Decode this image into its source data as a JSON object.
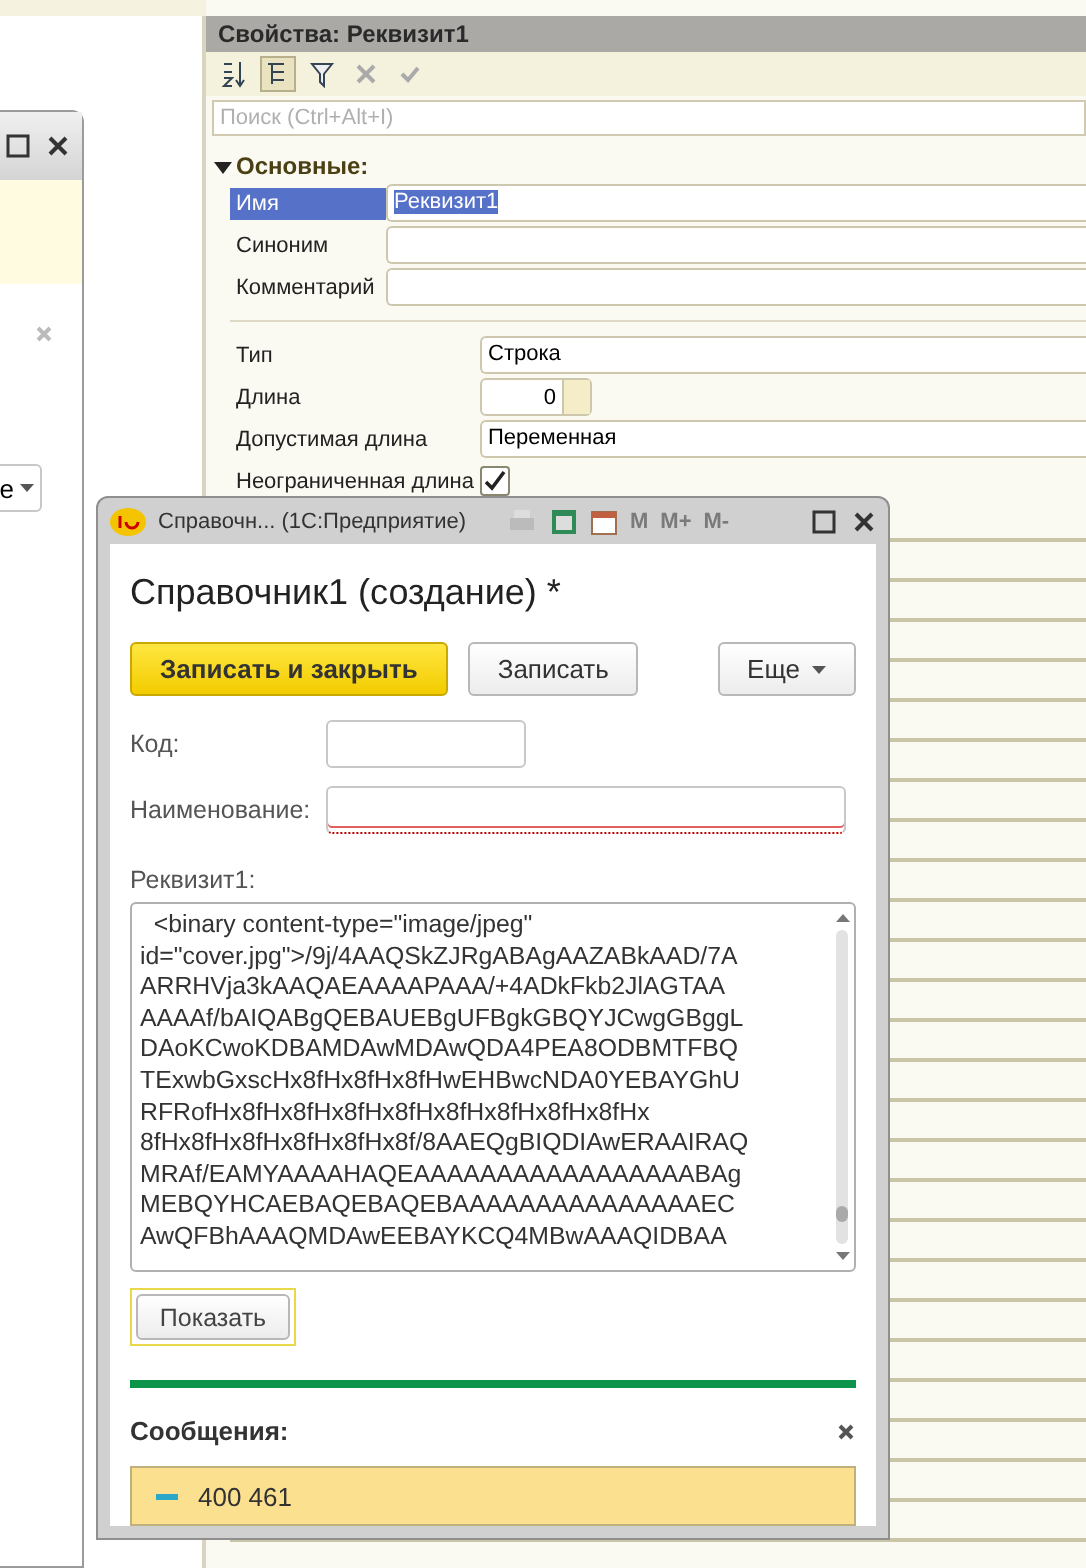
{
  "back_window": {
    "dropdown_text": "е"
  },
  "properties": {
    "title": "Свойства: Реквизит1",
    "toolbar": [
      {
        "kind": "sort",
        "pressed": false
      },
      {
        "kind": "tree",
        "pressed": true
      },
      {
        "kind": "filter",
        "pressed": false
      },
      {
        "kind": "delete",
        "pressed": false
      },
      {
        "kind": "apply",
        "pressed": false
      }
    ],
    "search": {
      "placeholder": "Поиск (Ctrl+Alt+I)"
    },
    "group": {
      "label": "Основные:",
      "expanded": true
    },
    "main_rows": [
      {
        "label": "Имя",
        "value": "Реквизит1",
        "selected": true
      },
      {
        "label": "Синоним",
        "selected": false
      },
      {
        "label": "Комментарий",
        "selected": false
      }
    ],
    "type_rows": [
      {
        "kind": "text",
        "label": "Тип",
        "value": "Строка"
      },
      {
        "kind": "number",
        "label": "Длина",
        "value": "0"
      },
      {
        "kind": "text",
        "label": "Допустимая длина",
        "value": "Переменная"
      },
      {
        "kind": "checkbox",
        "label": "Неограниченная длина",
        "checked": true
      }
    ]
  },
  "dialog": {
    "title": "Справочн... (1С:Предприятие)",
    "calc_buttons": [
      "M",
      "M+",
      "M-"
    ],
    "heading": "Справочник1 (создание) *",
    "buttons": [
      {
        "kind": "primary",
        "label": "Записать и закрыть"
      },
      {
        "kind": "default",
        "label": "Записать"
      },
      {
        "kind": "menu",
        "label": "Еще"
      }
    ],
    "fields": [
      {
        "label": "Код:",
        "wide": false,
        "required": false
      },
      {
        "label": "Наименование:",
        "wide": true,
        "required": true
      }
    ],
    "attribute": {
      "label": "Реквизит1:",
      "lines": [
        "  <binary content-type=\"image/jpeg\"",
        "id=\"cover.jpg\">/9j/4AAQSkZJRgABAgAAZABkAAD/7A",
        "ARRHVja3kAAQAEAAAAPAAA/+4ADkFkb2JlAGTAA",
        "AAAAf/bAIQABgQEBAUEBgUFBgkGBQYJCwgGBggL",
        "DAoKCwoKDBAMDAwMDAwQDA4PEA8ODBMTFBQ",
        "TExwbGxscHx8fHx8fHx8fHwEHBwcNDA0YEBAYGhU",
        "RFRofHx8fHx8fHx8fHx8fHx8fHx8fHx8fHx8fHx",
        "8fHx8fHx8fHx8fHx8fHx8f/8AAEQgBIQDIAwERAAIRAQ",
        "MRAf/EAMYAAAAHAQEAAAAAAAAAAAAAAAAABAg",
        "MEBQYHCAEBAQEBAQEBAAAAAAAAAAAAAAAEC",
        "AwQFBhAAAQMDAwEEBAYKCQ4MBwAAAQIDBAA"
      ]
    },
    "show_button": "Показать",
    "messages": {
      "title": "Сообщения:",
      "items": [
        {
          "text": "400 461"
        }
      ]
    }
  }
}
